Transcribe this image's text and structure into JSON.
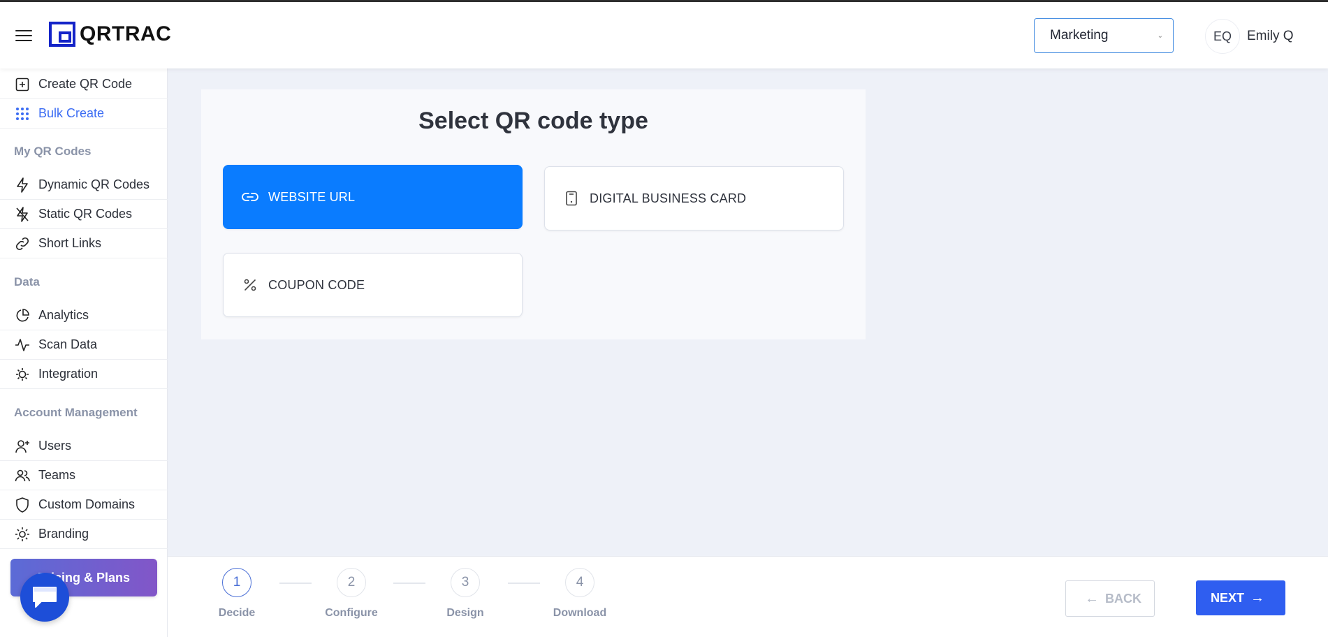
{
  "header": {
    "logo_text": "QRTRAC",
    "team_selected": "Marketing",
    "avatar_initials": "EQ",
    "user_name": "Emily Q"
  },
  "sidebar": {
    "items_top": [
      {
        "label": "Create QR Code",
        "icon": "plus-square-icon"
      },
      {
        "label": "Bulk Create",
        "icon": "grid-dots-icon",
        "active": true
      }
    ],
    "section_my_qr": "My QR Codes",
    "items_qr": [
      {
        "label": "Dynamic QR Codes",
        "icon": "lightning-icon"
      },
      {
        "label": "Static QR Codes",
        "icon": "lightning-off-icon"
      },
      {
        "label": "Short Links",
        "icon": "link-icon"
      }
    ],
    "section_data": "Data",
    "items_data": [
      {
        "label": "Analytics",
        "icon": "pie-chart-icon"
      },
      {
        "label": "Scan Data",
        "icon": "activity-icon"
      },
      {
        "label": "Integration",
        "icon": "plug-icon"
      }
    ],
    "section_account": "Account Management",
    "items_account": [
      {
        "label": "Users",
        "icon": "user-plus-icon"
      },
      {
        "label": "Teams",
        "icon": "users-icon"
      },
      {
        "label": "Custom Domains",
        "icon": "shield-icon"
      },
      {
        "label": "Branding",
        "icon": "sun-icon"
      }
    ],
    "pricing_label": "Pricing & Plans"
  },
  "main": {
    "title": "Select QR code type",
    "types": [
      {
        "label": "WEBSITE URL",
        "icon": "link-icon",
        "selected": true
      },
      {
        "label": "DIGITAL BUSINESS CARD",
        "icon": "phone-card-icon",
        "selected": false
      },
      {
        "label": "COUPON CODE",
        "icon": "percent-icon",
        "selected": false
      }
    ]
  },
  "stepper": {
    "steps": [
      {
        "num": "1",
        "label": "Decide"
      },
      {
        "num": "2",
        "label": "Configure"
      },
      {
        "num": "3",
        "label": "Design"
      },
      {
        "num": "4",
        "label": "Download"
      }
    ],
    "back_label": "BACK",
    "next_label": "NEXT"
  },
  "colors": {
    "primary": "#0a7cff",
    "next_button": "#2f5ef0",
    "active_nav": "#3b6cf3",
    "background": "#eef1f8"
  }
}
